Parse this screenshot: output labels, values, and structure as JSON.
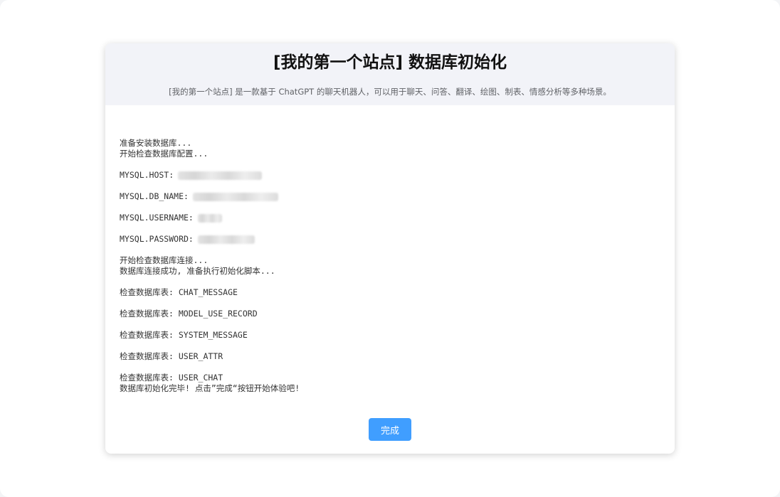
{
  "header": {
    "title": "[我的第一个站点] 数据库初始化",
    "subtitle": "[我的第一个站点] 是一款基于 ChatGPT 的聊天机器人，可以用于聊天、问答、翻译、绘图、制表、情感分析等多种场景。"
  },
  "log": {
    "preparing": "准备安装数据库...",
    "check_config": "开始检查数据库配置...",
    "host_label": "MYSQL.HOST:",
    "db_name_label": "MYSQL.DB_NAME:",
    "username_label": "MYSQL.USERNAME:",
    "password_label": "MYSQL.PASSWORD:",
    "check_connection": "开始检查数据库连接...",
    "connect_success": "数据库连接成功, 准备执行初始化脚本...",
    "table_1": "检查数据库表: CHAT_MESSAGE",
    "table_2": "检查数据库表: MODEL_USE_RECORD",
    "table_3": "检查数据库表: SYSTEM_MESSAGE",
    "table_4": "检查数据库表: USER_ATTR",
    "table_5": "检查数据库表: USER_CHAT",
    "finished": "数据库初始化完毕! 点击”完成“按钮开始体验吧!"
  },
  "actions": {
    "done_label": "完成"
  },
  "colors": {
    "primary": "#409eff",
    "header_bg": "#f2f3f8"
  }
}
